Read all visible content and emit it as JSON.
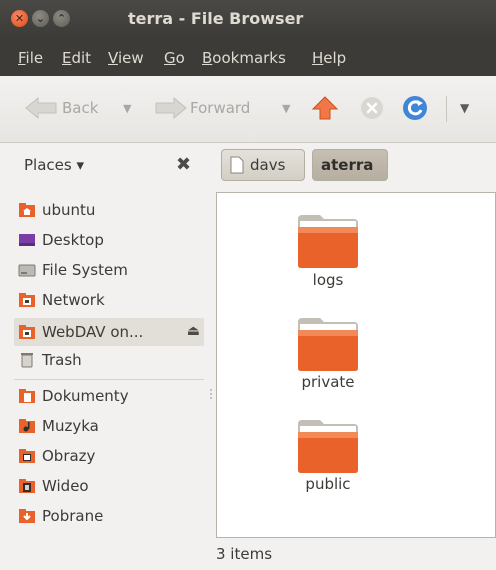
{
  "window": {
    "title": "terra - File Browser"
  },
  "menubar": {
    "file": "F",
    "file_rest": "ile",
    "edit": "E",
    "edit_rest": "dit",
    "view": "V",
    "view_rest": "iew",
    "go": "G",
    "go_rest": "o",
    "bookmarks": "B",
    "bookmarks_rest": "ookmarks",
    "help": "H",
    "help_rest": "elp"
  },
  "toolbar": {
    "back_label": "Back",
    "forward_label": "Forward"
  },
  "sidebar": {
    "header_label": "Places ▾",
    "items": [
      {
        "label": "ubuntu",
        "icon": "home-folder-icon"
      },
      {
        "label": "Desktop",
        "icon": "desktop-icon"
      },
      {
        "label": "File System",
        "icon": "drive-icon"
      },
      {
        "label": "Network",
        "icon": "network-icon"
      },
      {
        "label": "WebDAV on...",
        "icon": "network-share-icon"
      },
      {
        "label": "Trash",
        "icon": "trash-icon"
      },
      {
        "label": "Dokumenty",
        "icon": "documents-folder-icon"
      },
      {
        "label": "Muzyka",
        "icon": "music-folder-icon"
      },
      {
        "label": "Obrazy",
        "icon": "pictures-folder-icon"
      },
      {
        "label": "Wideo",
        "icon": "videos-folder-icon"
      },
      {
        "label": "Pobrane",
        "icon": "downloads-folder-icon"
      }
    ]
  },
  "pathbar": {
    "crumbs": [
      "davs",
      "aterra"
    ]
  },
  "files": [
    {
      "name": "logs"
    },
    {
      "name": "private"
    },
    {
      "name": "public"
    }
  ],
  "status": {
    "text": "3 items"
  },
  "colors": {
    "folder": "#e8622a",
    "titlebar": "#3c3b37",
    "accent": "#f07746"
  }
}
